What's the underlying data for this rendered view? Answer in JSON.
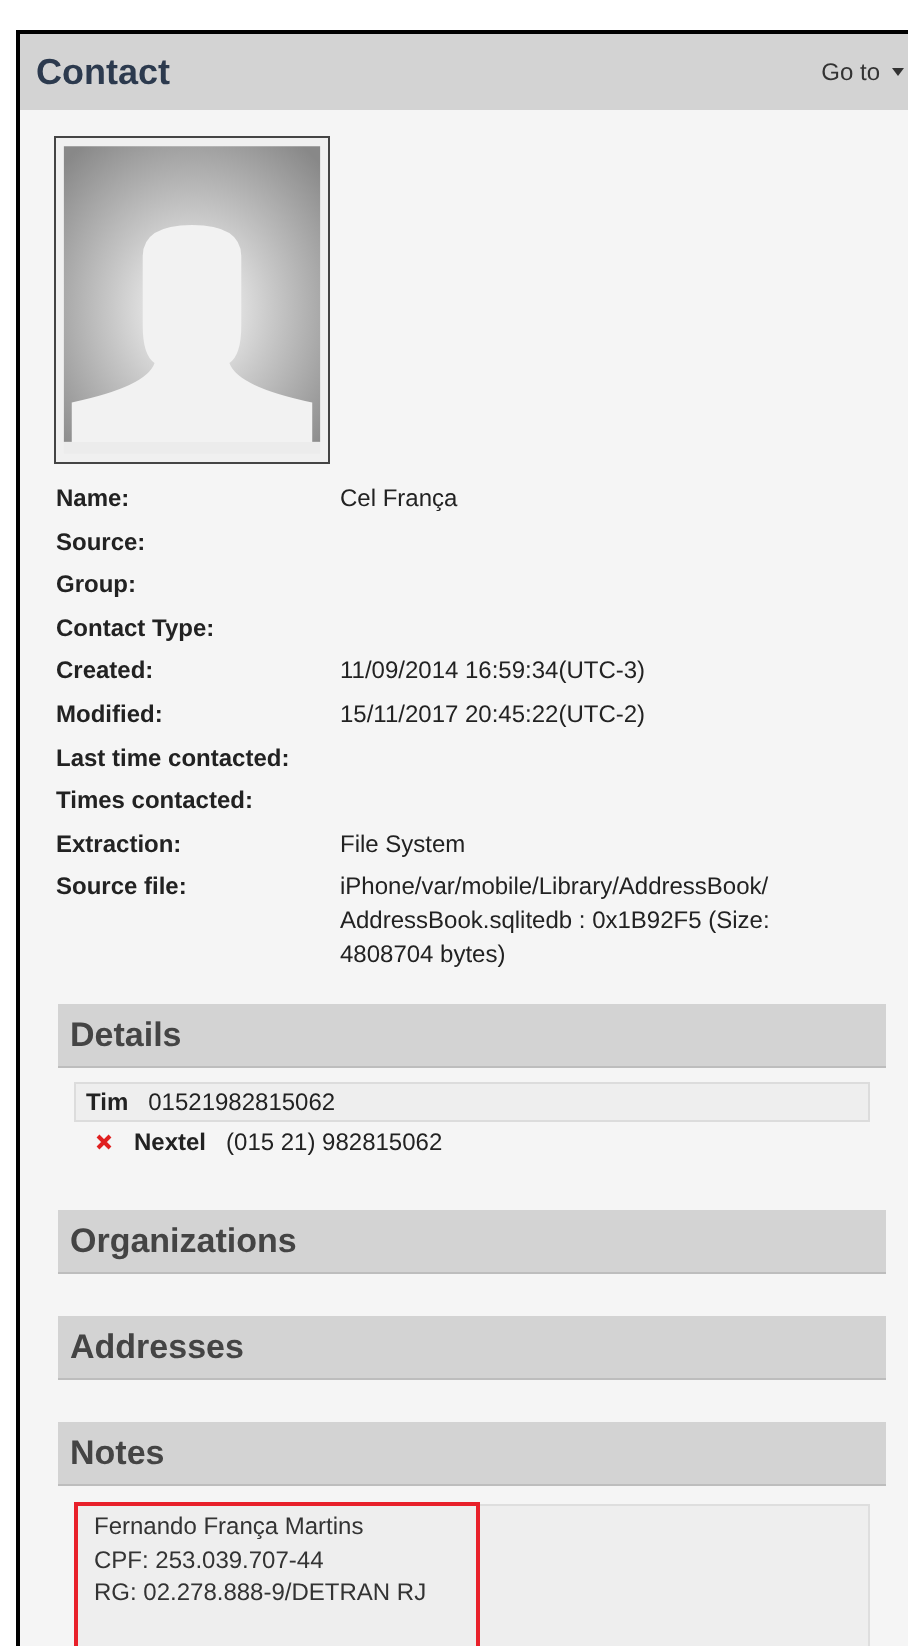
{
  "header": {
    "title": "Contact",
    "goto": "Go to"
  },
  "fields": [
    {
      "label": "Name:",
      "value": "Cel França"
    },
    {
      "label": "Source:"
    },
    {
      "label": "Group:"
    },
    {
      "label": "Contact Type:"
    },
    {
      "label": "Created:",
      "value": "11/09/2014 16:59:34(UTC-3)"
    },
    {
      "label": "Modified:",
      "value": "15/11/2017 20:45:22(UTC-2)"
    },
    {
      "label": "Last time contacted:"
    },
    {
      "label": "Times contacted:"
    },
    {
      "label": "Extraction:",
      "value": "File System"
    },
    {
      "label": "Source file:",
      "value": "iPhone/var/mobile/Library/AddressBook/ AddressBook.sqlitedb : 0x1B92F5 (Size: 4808704 bytes)"
    }
  ],
  "sections": [
    {
      "title": "Details",
      "kind": "phones",
      "entries": [
        {
          "label": "Tim",
          "number": "01521982815062",
          "selected": true,
          "deleted": false
        },
        {
          "label": "Nextel",
          "number": "(015 21) 982815062",
          "selected": false,
          "deleted": true
        }
      ]
    },
    {
      "title": "Organizations",
      "kind": "empty"
    },
    {
      "title": "Addresses",
      "kind": "empty"
    },
    {
      "title": "Notes",
      "kind": "notes",
      "lines": [
        "Fernando França Martins",
        "CPF: 253.039.707-44",
        "RG: 02.278.888-9/DETRAN RJ"
      ],
      "highlighted": true
    }
  ]
}
